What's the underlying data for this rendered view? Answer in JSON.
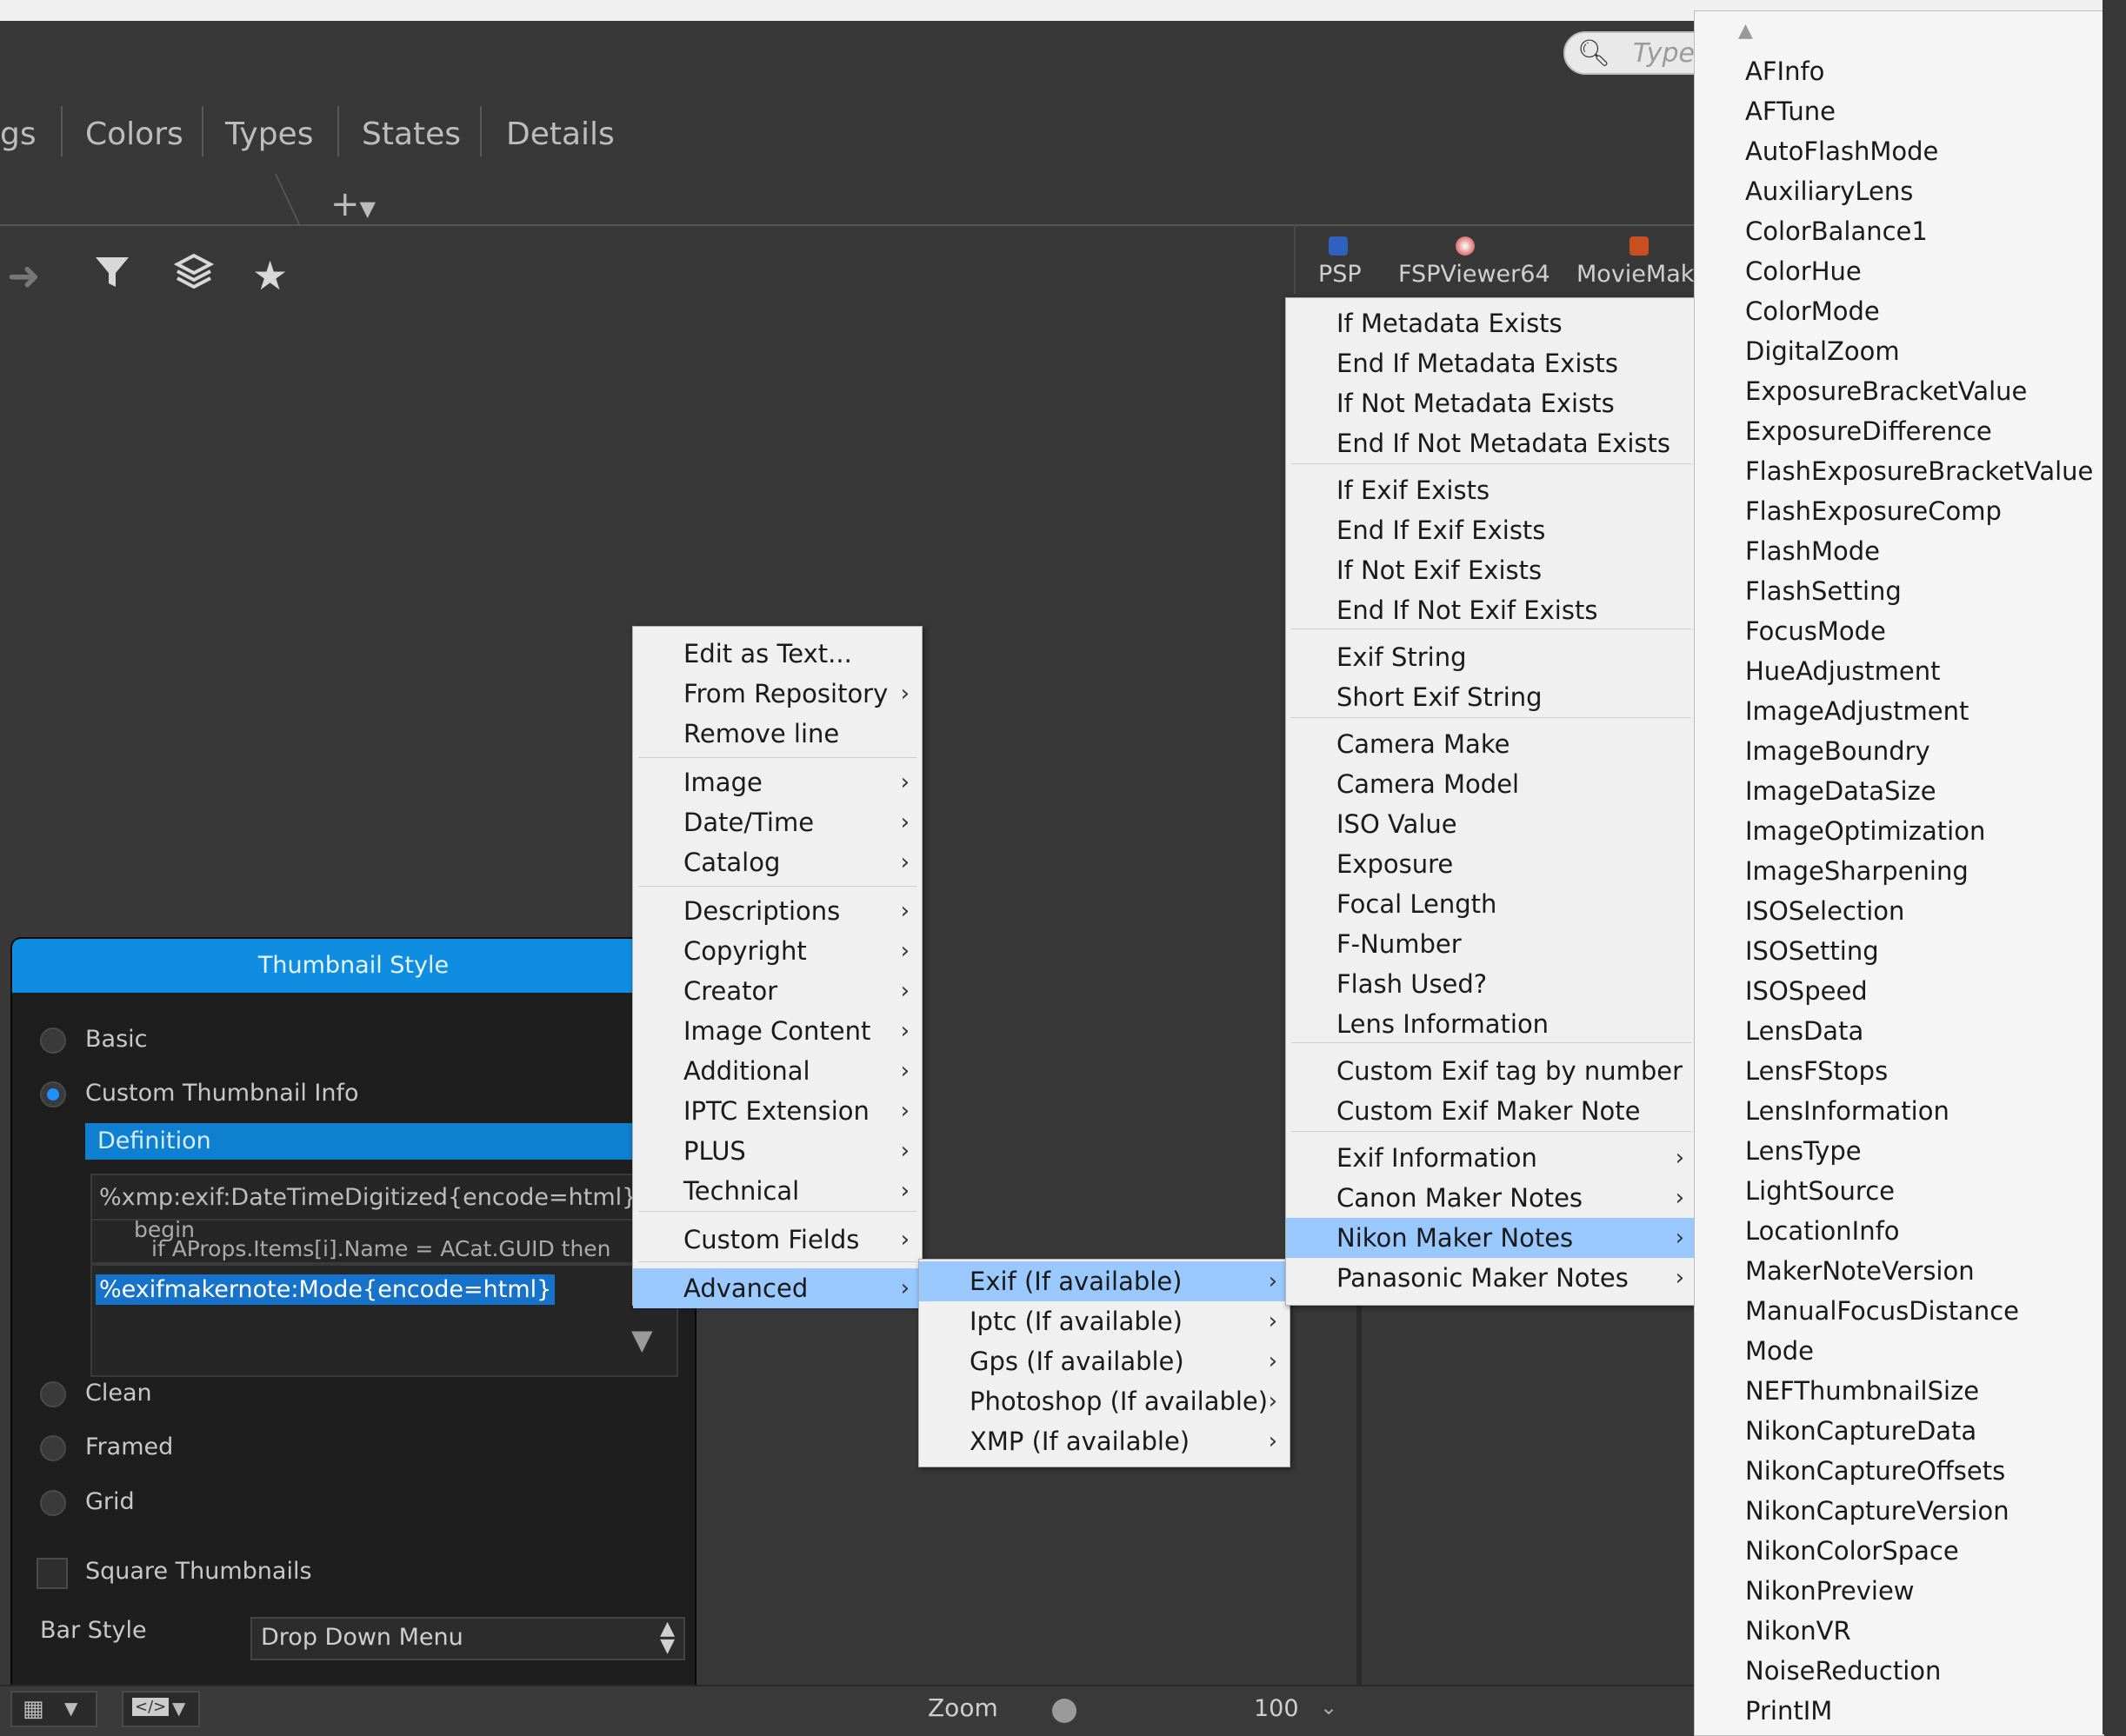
{
  "tabs": [
    "gs",
    "Colors",
    "Types",
    "States",
    "Details"
  ],
  "add_tab": "+",
  "search_placeholder": "Type",
  "apps": [
    "PSP",
    "FSPViewer64",
    "MovieMake"
  ],
  "panel": {
    "title": "Thumbnail Style",
    "options": [
      "Basic",
      "Custom Thumbnail Info",
      "Clean",
      "Framed",
      "Grid"
    ],
    "definition_label": "Definition",
    "code_line1": "%xmp:exif:DateTimeDigitized{encode=html}  <",
    "code_line2": "begin",
    "code_line3": "if AProps.Items[i].Name = ACat.GUID then",
    "selected_value": "%exifmakernote:Mode{encode=html}",
    "square_label": "Square Thumbnails",
    "barstyle_label": "Bar Style",
    "barstyle_value": "Drop Down Menu"
  },
  "bottom": {
    "zoom_label": "Zoom",
    "zoom_value": "100"
  },
  "menu1": [
    {
      "label": "Edit as Text...",
      "sub": false
    },
    {
      "label": "From Repository",
      "sub": true
    },
    {
      "label": "Remove line",
      "sub": false
    },
    {
      "label": "Image",
      "sub": true
    },
    {
      "label": "Date/Time",
      "sub": true
    },
    {
      "label": "Catalog",
      "sub": true
    },
    {
      "label": "Descriptions",
      "sub": true
    },
    {
      "label": "Copyright",
      "sub": true
    },
    {
      "label": "Creator",
      "sub": true
    },
    {
      "label": "Image Content",
      "sub": true
    },
    {
      "label": "Additional",
      "sub": true
    },
    {
      "label": "IPTC Extension",
      "sub": true
    },
    {
      "label": "PLUS",
      "sub": true
    },
    {
      "label": "Technical",
      "sub": true
    },
    {
      "label": "Custom Fields",
      "sub": true
    },
    {
      "label": "Advanced",
      "sub": true,
      "highlight": true
    }
  ],
  "menu2": [
    {
      "label": "Exif (If available)",
      "sub": true,
      "highlight": true
    },
    {
      "label": "Iptc (If available)",
      "sub": true
    },
    {
      "label": "Gps (If available)",
      "sub": true
    },
    {
      "label": "Photoshop (If available)",
      "sub": true
    },
    {
      "label": "XMP (If available)",
      "sub": true
    }
  ],
  "menu3": [
    {
      "label": "If Metadata Exists"
    },
    {
      "label": "End If Metadata Exists"
    },
    {
      "label": "If Not Metadata Exists"
    },
    {
      "label": "End If Not Metadata Exists"
    },
    {
      "label": "If Exif Exists"
    },
    {
      "label": "End If Exif Exists"
    },
    {
      "label": "If Not Exif Exists"
    },
    {
      "label": "End If Not Exif Exists"
    },
    {
      "label": "Exif String"
    },
    {
      "label": "Short Exif String"
    },
    {
      "label": "Camera Make"
    },
    {
      "label": "Camera Model"
    },
    {
      "label": "ISO Value"
    },
    {
      "label": "Exposure"
    },
    {
      "label": "Focal Length"
    },
    {
      "label": "F-Number"
    },
    {
      "label": "Flash Used?"
    },
    {
      "label": "Lens Information"
    },
    {
      "label": "Custom Exif tag by number"
    },
    {
      "label": "Custom Exif Maker Note"
    },
    {
      "label": "Exif Information",
      "sub": true
    },
    {
      "label": "Canon Maker Notes",
      "sub": true
    },
    {
      "label": "Nikon Maker Notes",
      "sub": true,
      "highlight": true
    },
    {
      "label": "Panasonic Maker Notes",
      "sub": true
    }
  ],
  "menu4": [
    "AFInfo",
    "AFTune",
    "AutoFlashMode",
    "AuxiliaryLens",
    "ColorBalance1",
    "ColorHue",
    "ColorMode",
    "DigitalZoom",
    "ExposureBracketValue",
    "ExposureDifference",
    "FlashExposureBracketValue",
    "FlashExposureComp",
    "FlashMode",
    "FlashSetting",
    "FocusMode",
    "HueAdjustment",
    "ImageAdjustment",
    "ImageBoundry",
    "ImageDataSize",
    "ImageOptimization",
    "ImageSharpening",
    "ISOSelection",
    "ISOSetting",
    "ISOSpeed",
    "LensData",
    "LensFStops",
    "LensInformation",
    "LensType",
    "LightSource",
    "LocationInfo",
    "MakerNoteVersion",
    "ManualFocusDistance",
    "Mode",
    "NEFThumbnailSize",
    "NikonCaptureData",
    "NikonCaptureOffsets",
    "NikonCaptureVersion",
    "NikonColorSpace",
    "NikonPreview",
    "NikonVR",
    "NoiseReduction",
    "PrintIM"
  ]
}
